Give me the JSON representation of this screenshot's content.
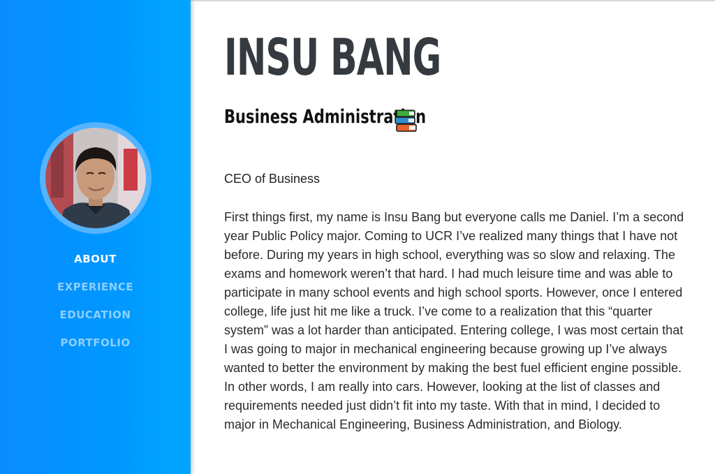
{
  "profile": {
    "name": "INSU BANG",
    "subtitle": "Business Administration",
    "subtitle_icon": "books-icon",
    "tagline": "CEO of Business",
    "bio": "First things first, my name is Insu Bang but everyone calls me Daniel. I’m a second year Public Policy major. Coming to UCR I’ve realized many things that I have not before. During my years in high school, everything was so slow and relaxing. The exams and homework weren’t that hard. I had much leisure time and was able to participate in many school events and high school sports. However, once I entered college, life just hit me like a truck. I’ve come to a realization that this “quarter system” was a lot harder than anticipated. Entering college, I was most certain that I was going to major in mechanical engineering because growing up I’ve always wanted to better the environment by making the best fuel efficient engine possible. In other words, I am really into cars. However, looking at the list of classes and requirements needed just didn’t fit into my taste. With that in mind, I decided to major in Mechanical Engineering, Business Administration, and Biology."
  },
  "sidebar": {
    "nav": [
      {
        "label": "ABOUT",
        "active": true
      },
      {
        "label": "EXPERIENCE",
        "active": false
      },
      {
        "label": "EDUCATION",
        "active": false
      },
      {
        "label": "PORTFOLIO",
        "active": false
      }
    ]
  },
  "colors": {
    "sidebar": "#0096ff",
    "heading": "#343a40",
    "nav_active": "#ffffff"
  }
}
